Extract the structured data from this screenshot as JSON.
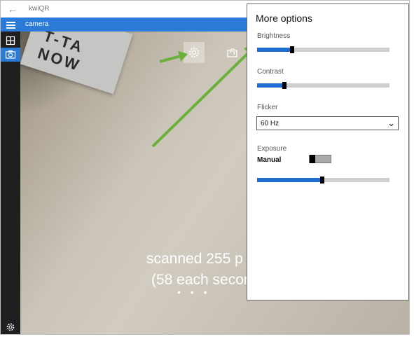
{
  "window": {
    "title": "kwiQR",
    "back_glyph": "←"
  },
  "appbar": {
    "page_title": "camera"
  },
  "sidebar": {
    "items": [
      {
        "icon": "hamburger-icon"
      },
      {
        "icon": "qr-grid-icon"
      },
      {
        "icon": "camera-icon"
      }
    ],
    "bottom_icon": "gear-icon"
  },
  "camera_view": {
    "paper_text": "T-TA NOW",
    "status_line1": "scanned 255 p",
    "status_line2": "(58 each secor",
    "progress_dots": "• • •",
    "settings_icon": "gear-icon",
    "switch_camera_icon": "camera-rotate-icon"
  },
  "options_panel": {
    "title": "More options",
    "brightness": {
      "label": "Brightness",
      "value": 0.265
    },
    "contrast": {
      "label": "Contrast",
      "value": 0.205
    },
    "flicker": {
      "label": "Flicker",
      "selected": "60 Hz",
      "chevron": "⌄"
    },
    "exposure": {
      "label": "Exposure",
      "mode_label": "Manual",
      "auto_toggle_on": false,
      "value": 0.49
    }
  },
  "colors": {
    "accent": "#2b7bd6",
    "slider_fill": "#1f6dd1",
    "annotation_arrow": "#6ab03a"
  }
}
